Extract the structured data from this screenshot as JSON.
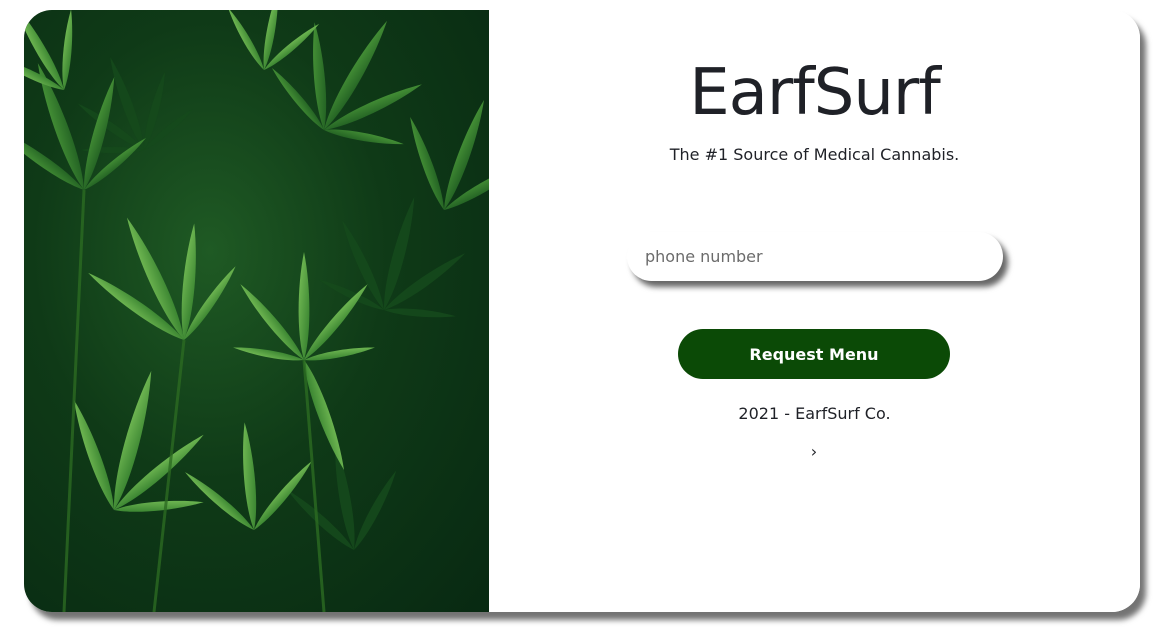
{
  "brand": {
    "title": "EarfSurf",
    "tagline": "The #1 Source of Medical Cannabis."
  },
  "form": {
    "phone_placeholder": "phone number",
    "phone_value": "",
    "submit_label": "Request Menu"
  },
  "footer": {
    "copyright": "2021 - EarfSurf Co.",
    "next_icon": "chevron-right-icon",
    "next_glyph": "›"
  },
  "colors": {
    "button_bg": "#0b4a06",
    "text": "#1f2127",
    "leaf_dark": "#0f3a17",
    "leaf_light": "#5fa846"
  },
  "image": {
    "subject": "cannabis-leaves-photo"
  }
}
